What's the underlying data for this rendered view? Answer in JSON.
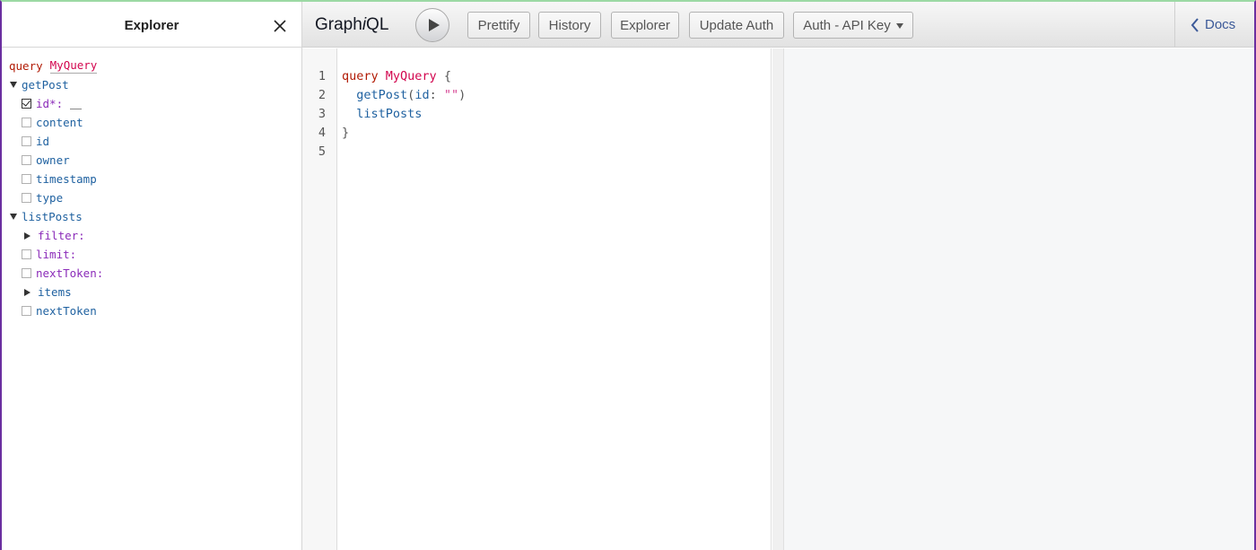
{
  "explorer": {
    "title": "Explorer",
    "query_keyword": "query",
    "query_name": "MyQuery",
    "get_post": {
      "name": "getPost",
      "arg_id": "id*:",
      "fields": [
        "content",
        "id",
        "owner",
        "timestamp",
        "type"
      ]
    },
    "list_posts": {
      "name": "listPosts",
      "filter": "filter:",
      "limit": "limit:",
      "next_token_arg": "nextToken:",
      "items": "items",
      "next_token_field": "nextToken"
    }
  },
  "toolbar": {
    "title_pre": "Graph",
    "title_i": "i",
    "title_post": "QL",
    "prettify": "Prettify",
    "history": "History",
    "explorer": "Explorer",
    "update_auth": "Update Auth",
    "auth_mode": "Auth - API Key",
    "docs": "Docs"
  },
  "editor": {
    "line_numbers": [
      "1",
      "2",
      "3",
      "4",
      "5"
    ],
    "line1": {
      "kw": "query",
      "name": "MyQuery",
      "brace": "{"
    },
    "line2": {
      "field": "getPost",
      "open": "(",
      "arg": "id",
      "colon": ": ",
      "value": "\"\"",
      "close": ")"
    },
    "line3": {
      "field": "listPosts"
    },
    "line4": {
      "brace": "}"
    }
  },
  "colors": {
    "keyword": "#b11a04",
    "definition": "#d2054e",
    "field": "#1f61a0",
    "argument": "#8b2bb9",
    "string": "#d64292",
    "docs_link": "#3b5998"
  }
}
